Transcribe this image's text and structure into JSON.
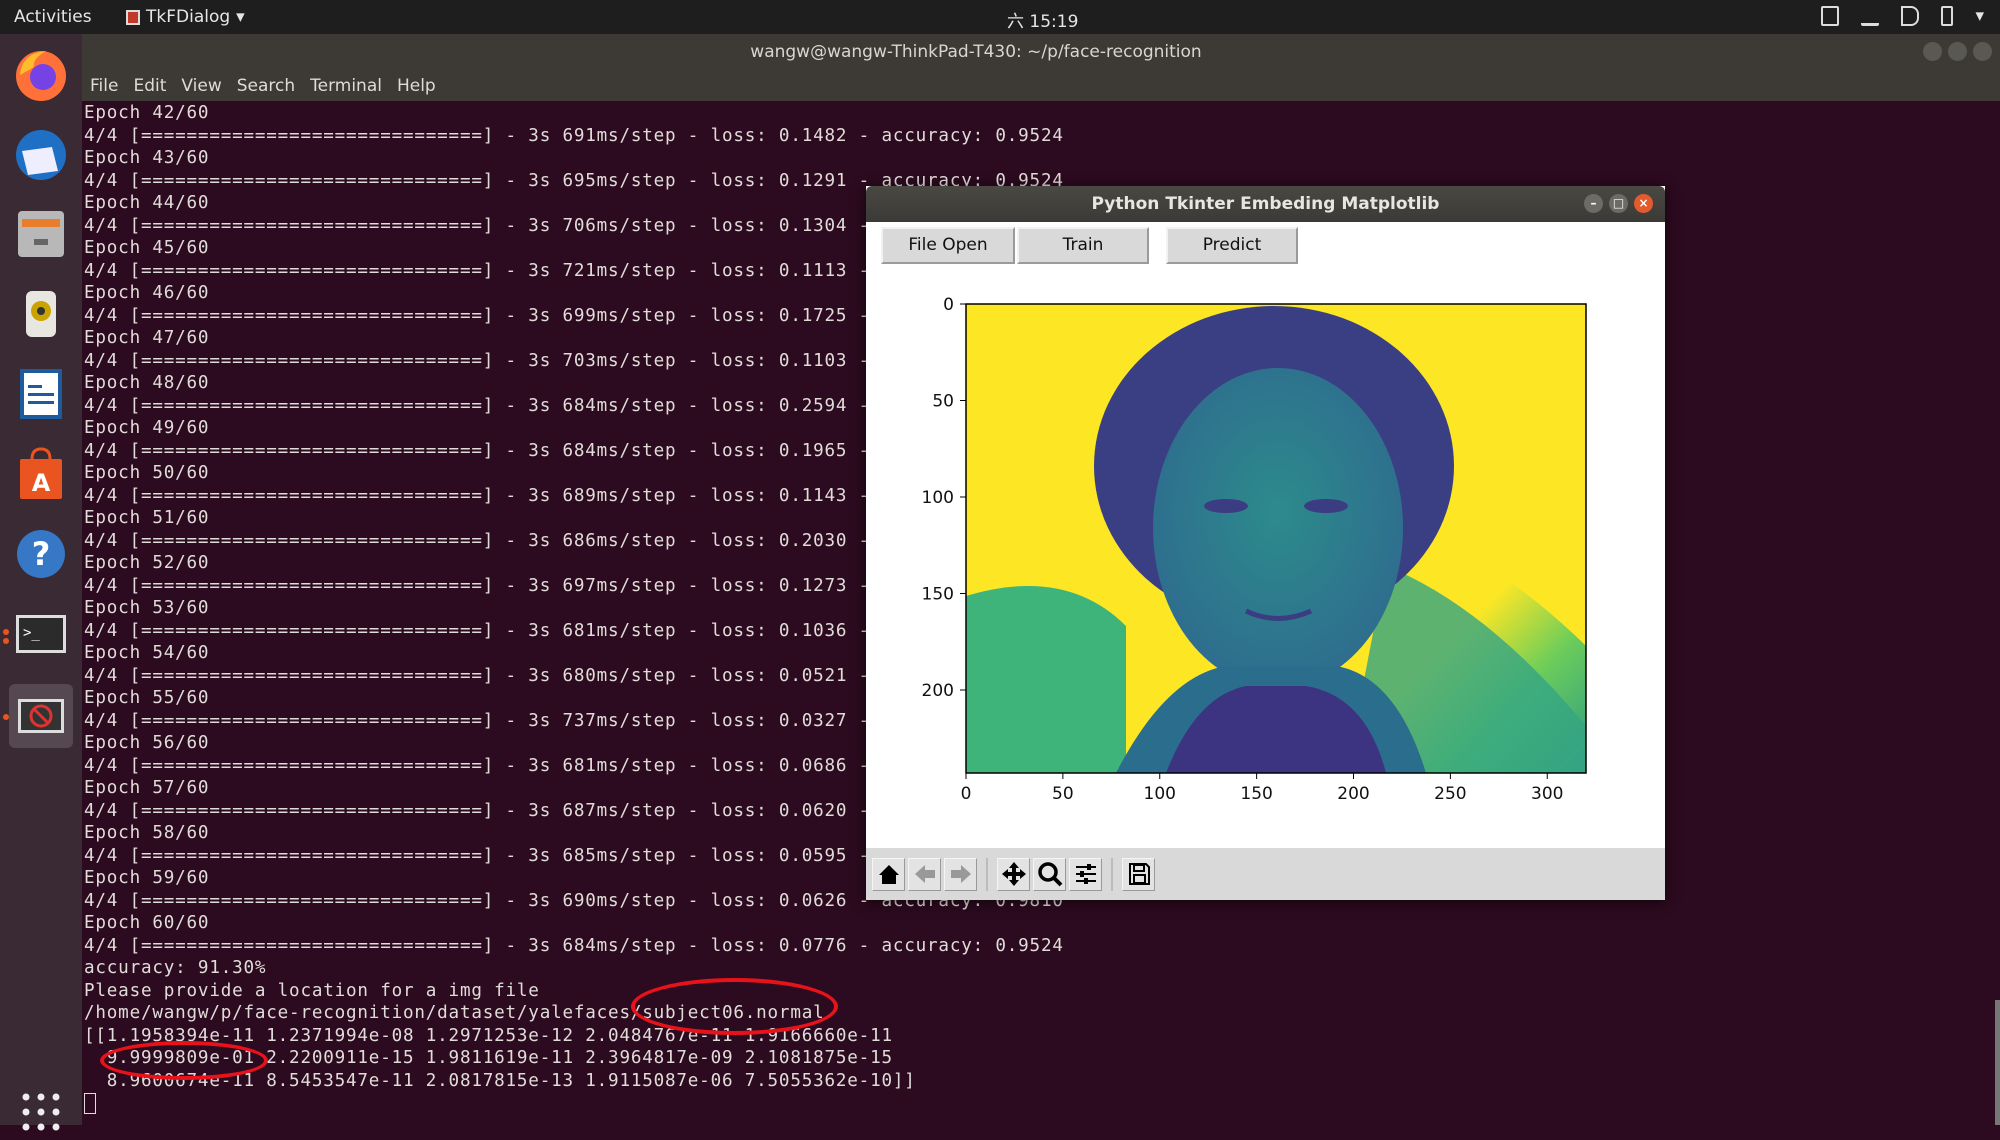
{
  "topbar": {
    "activities": "Activities",
    "app_name": "TkFDialog",
    "clock": "六 15:19"
  },
  "dock": {
    "items": [
      "firefox",
      "thunderbird",
      "files",
      "rhythmbox",
      "libreoffice-writer",
      "ubuntu-software",
      "help",
      "terminal",
      "tk-app"
    ]
  },
  "terminal": {
    "title": "wangw@wangw-ThinkPad-T430: ~/p/face-recognition",
    "menu": [
      "File",
      "Edit",
      "View",
      "Search",
      "Terminal",
      "Help"
    ],
    "lines": [
      "Epoch 42/60",
      "4/4 [==============================] - 3s 691ms/step - loss: 0.1482 - accuracy: 0.9524",
      "Epoch 43/60",
      "4/4 [==============================] - 3s 695ms/step - loss: 0.1291 - accuracy: 0.9524",
      "Epoch 44/60",
      "4/4 [==============================] - 3s 706ms/step - loss: 0.1304 -",
      "Epoch 45/60",
      "4/4 [==============================] - 3s 721ms/step - loss: 0.1113 -",
      "Epoch 46/60",
      "4/4 [==============================] - 3s 699ms/step - loss: 0.1725 -",
      "Epoch 47/60",
      "4/4 [==============================] - 3s 703ms/step - loss: 0.1103 -",
      "Epoch 48/60",
      "4/4 [==============================] - 3s 684ms/step - loss: 0.2594 -",
      "Epoch 49/60",
      "4/4 [==============================] - 3s 684ms/step - loss: 0.1965 -",
      "Epoch 50/60",
      "4/4 [==============================] - 3s 689ms/step - loss: 0.1143 -",
      "Epoch 51/60",
      "4/4 [==============================] - 3s 686ms/step - loss: 0.2030 -",
      "Epoch 52/60",
      "4/4 [==============================] - 3s 697ms/step - loss: 0.1273 -",
      "Epoch 53/60",
      "4/4 [==============================] - 3s 681ms/step - loss: 0.1036 -",
      "Epoch 54/60",
      "4/4 [==============================] - 3s 680ms/step - loss: 0.0521 -",
      "Epoch 55/60",
      "4/4 [==============================] - 3s 737ms/step - loss: 0.0327 -",
      "Epoch 56/60",
      "4/4 [==============================] - 3s 681ms/step - loss: 0.0686 -",
      "Epoch 57/60",
      "4/4 [==============================] - 3s 687ms/step - loss: 0.0620 -",
      "Epoch 58/60",
      "4/4 [==============================] - 3s 685ms/step - loss: 0.0595 -",
      "Epoch 59/60",
      "4/4 [==============================] - 3s 690ms/step - loss: 0.0626 - accuracy: 0.9810",
      "Epoch 60/60",
      "4/4 [==============================] - 3s 684ms/step - loss: 0.0776 - accuracy: 0.9524",
      "accuracy: 91.30%",
      "Please provide a location for a img file",
      "/home/wangw/p/face-recognition/dataset/yalefaces/subject06.normal",
      "[[1.1958394e-11 1.2371994e-08 1.2971253e-12 2.0484767e-11 1.9166660e-11",
      "  9.9999809e-01 2.2200911e-15 1.9811619e-11 2.3964817e-09 2.1081875e-15",
      "  8.9600674e-11 8.5453547e-11 2.0817815e-13 1.9115087e-06 7.5055362e-10]]"
    ]
  },
  "tk_window": {
    "title": "Python Tkinter Embeding Matplotlib",
    "buttons": {
      "file_open": "File Open",
      "train": "Train",
      "predict": "Predict"
    },
    "toolbar": [
      "home-icon",
      "back-icon",
      "forward-icon",
      "pan-icon",
      "zoom-icon",
      "configure-subplots-icon",
      "save-icon"
    ]
  },
  "chart_data": {
    "type": "image",
    "colormap": "viridis",
    "image_size": [
      320,
      243
    ],
    "xlim": [
      0,
      320
    ],
    "ylim": [
      243,
      0
    ],
    "xticks": [
      "0",
      "50",
      "100",
      "150",
      "200",
      "250",
      "300"
    ],
    "yticks": [
      "0",
      "50",
      "100",
      "150",
      "200"
    ],
    "content": "grayscale face rendered with viridis colormap"
  },
  "annotations": {
    "color": "#e8121a"
  },
  "colors": {
    "terminal_bg": "#2c0a1f",
    "accent": "#e95420"
  }
}
